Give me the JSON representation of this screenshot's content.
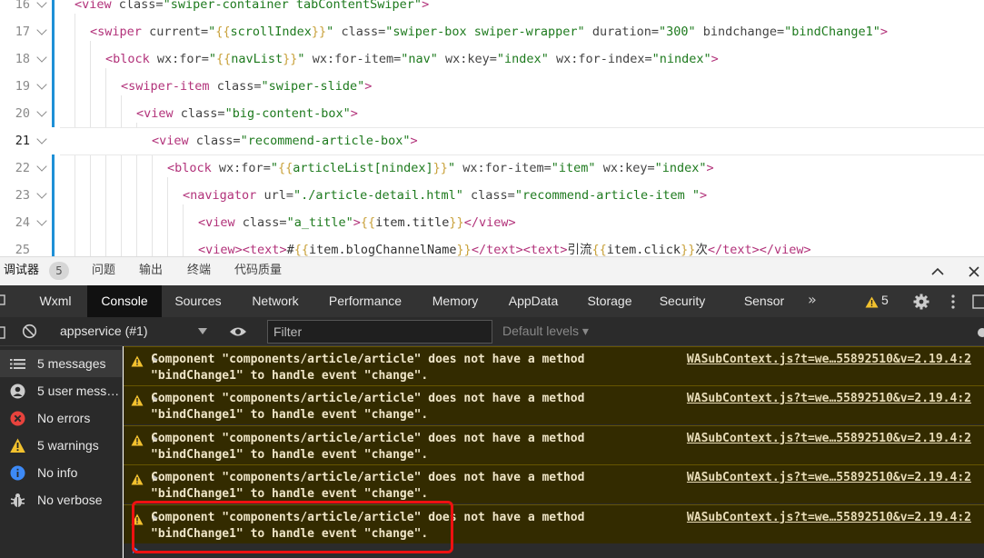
{
  "editor": {
    "lines": [
      {
        "num": "16",
        "html": "<span class=\"bkt\">&lt;</span><span class=\"tg\">view</span> <span class=\"at\">class=</span><span class=\"st\">\"swiper-container tabContentSwiper\"</span><span class=\"bkt\">&gt;</span>"
      },
      {
        "num": "17",
        "html": "<span class=\"bkt\">&lt;</span><span class=\"tg\">swiper</span> <span class=\"at\">current=</span><span class=\"st\">\"<span class=\"br\">{{</span>scrollIndex<span class=\"br\">}}</span>\"</span> <span class=\"at\">class=</span><span class=\"st\">\"swiper-box swiper-wrapper\"</span> <span class=\"at\">duration=</span><span class=\"st\">\"300\"</span> <span class=\"at\">bindchange=</span><span class=\"st\">\"bindChange1\"</span><span class=\"bkt\">&gt;</span>"
      },
      {
        "num": "18",
        "html": "<span class=\"bkt\">&lt;</span><span class=\"tg\">block</span> <span class=\"at\">wx:for=</span><span class=\"st\">\"<span class=\"br\">{{</span>navList<span class=\"br\">}}</span>\"</span> <span class=\"at\">wx:for-item=</span><span class=\"st\">\"nav\"</span> <span class=\"at\">wx:key=</span><span class=\"st\">\"index\"</span> <span class=\"at\">wx:for-index=</span><span class=\"st\">\"nindex\"</span><span class=\"bkt\">&gt;</span>"
      },
      {
        "num": "19",
        "html": "<span class=\"bkt\">&lt;</span><span class=\"tg\">swiper-item</span> <span class=\"at\">class=</span><span class=\"st\">\"swiper-slide\"</span><span class=\"bkt\">&gt;</span>"
      },
      {
        "num": "20",
        "html": "<span class=\"bkt\">&lt;</span><span class=\"tg\">view</span> <span class=\"at\">class=</span><span class=\"st\">\"big-content-box\"</span><span class=\"bkt\">&gt;</span>"
      },
      {
        "num": "21",
        "html": "<span class=\"bkt\">&lt;</span><span class=\"tg\">view</span> <span class=\"at\">class=</span><span class=\"st\">\"recommend-article-box\"</span><span class=\"bkt\">&gt;</span>"
      },
      {
        "num": "22",
        "html": "<span class=\"bkt\">&lt;</span><span class=\"tg\">block</span> <span class=\"at\">wx:for=</span><span class=\"st\">\"<span class=\"br\">{{</span>articleList[nindex]<span class=\"br\">}}</span>\"</span> <span class=\"at\">wx:for-item=</span><span class=\"st\">\"item\"</span> <span class=\"at\">wx:key=</span><span class=\"st\">\"index\"</span><span class=\"bkt\">&gt;</span>"
      },
      {
        "num": "23",
        "html": "<span class=\"bkt\">&lt;</span><span class=\"tg\">navigator</span> <span class=\"at\">url=</span><span class=\"st\">\"./article-detail.html\"</span> <span class=\"at\">class=</span><span class=\"st\">\"recommend-article-item \"</span><span class=\"bkt\">&gt;</span>"
      },
      {
        "num": "24",
        "html": "<span class=\"bkt\">&lt;</span><span class=\"tg\">view</span> <span class=\"at\">class=</span><span class=\"st\">\"a_title\"</span><span class=\"bkt\">&gt;</span><span class=\"br\" style=\"color:#c9a23c\">{{</span>item.title<span class=\"br\" style=\"color:#c9a23c\">}}</span><span class=\"bkt\">&lt;/</span><span class=\"tg\">view</span><span class=\"bkt\">&gt;</span>"
      },
      {
        "num": "25",
        "html": "<span class=\"bkt\">&lt;</span><span class=\"tg\">view</span><span class=\"bkt\">&gt;&lt;</span><span class=\"tg\">text</span><span class=\"bkt\">&gt;</span>#<span style=\"color:#c9a23c\">{{</span>item.blogChannelName<span style=\"color:#c9a23c\">}}</span><span class=\"bkt\">&lt;/</span><span class=\"tg\">text</span><span class=\"bkt\">&gt;&lt;</span><span class=\"tg\">text</span><span class=\"bkt\">&gt;</span>引流<span style=\"color:#c9a23c\">{{</span>item.click<span style=\"color:#c9a23c\">}}</span>次<span class=\"bkt\">&lt;/</span><span class=\"tg\">text</span><span class=\"bkt\">&gt;&lt;/</span><span class=\"tg\">view</span><span class=\"bkt\">&gt;</span>"
      }
    ],
    "active_line": "21"
  },
  "panel_tabs": {
    "debugger": "调试器",
    "debugger_badge": "5",
    "issues": "问题",
    "output": "输出",
    "terminal": "终端",
    "code_quality": "代码质量"
  },
  "devtools_tabs": [
    "Wxml",
    "Console",
    "Sources",
    "Network",
    "Performance",
    "Memory",
    "AppData",
    "Storage",
    "Security",
    "Sensor"
  ],
  "devtools_more": "»",
  "devtools_warning_count": "5",
  "toolbar": {
    "context": "appservice (#1)",
    "filter_placeholder": "Filter",
    "levels": "Default levels ▾"
  },
  "sidebar": {
    "items": [
      {
        "label": "5 messages",
        "icon": "list-icon"
      },
      {
        "label": "5 user mess…",
        "icon": "user-icon"
      },
      {
        "label": "No errors",
        "icon": "error-icon"
      },
      {
        "label": "5 warnings",
        "icon": "warning-icon"
      },
      {
        "label": "No info",
        "icon": "info-icon"
      },
      {
        "label": "No verbose",
        "icon": "bug-icon"
      }
    ]
  },
  "messages": [
    {
      "text": "Component \"components/article/article\" does not have a method\n\"bindChange1\" to handle event \"change\".",
      "source": "WASubContext.js?t=we…55892510&v=2.19.4:2"
    },
    {
      "text": "Component \"components/article/article\" does not have a method\n\"bindChange1\" to handle event \"change\".",
      "source": "WASubContext.js?t=we…55892510&v=2.19.4:2"
    },
    {
      "text": "Component \"components/article/article\" does not have a method\n\"bindChange1\" to handle event \"change\".",
      "source": "WASubContext.js?t=we…55892510&v=2.19.4:2"
    },
    {
      "text": "Component \"components/article/article\" does not have a method\n\"bindChange1\" to handle event \"change\".",
      "source": "WASubContext.js?t=we…55892510&v=2.19.4:2"
    },
    {
      "text": "Component \"components/article/article\" does not have a method\n\"bindChange1\" to handle event \"change\".",
      "source": "WASubContext.js?t=we…55892510&v=2.19.4:2"
    }
  ],
  "colors": {
    "warning_bg": "#332b00",
    "warning_border": "#665500",
    "highlight": "#ee1111",
    "gutter_accent": "#1e90d6"
  }
}
